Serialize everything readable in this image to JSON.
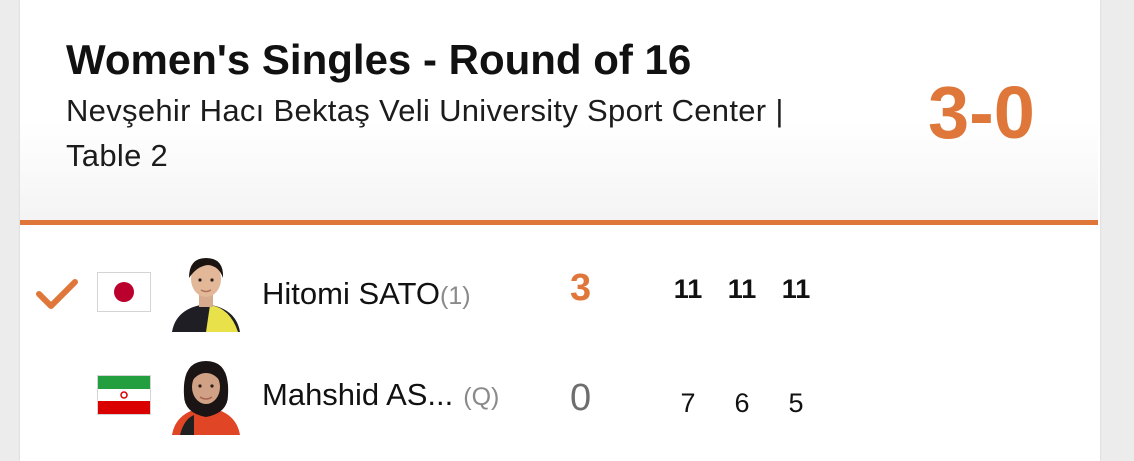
{
  "match": {
    "title": "Women's Singles - Round of 16",
    "venue": "Nevşehir Hacı Bektaş Veli University Sport Center | Table 2",
    "score": "3-0"
  },
  "players": [
    {
      "name": "Hitomi SATO",
      "seed": "(1)",
      "games": "3",
      "sets": [
        "11",
        "11",
        "11"
      ],
      "flag": "japan-flag",
      "winner": true
    },
    {
      "name": "Mahshid AS...",
      "seed": "(Q)",
      "games": "0",
      "sets": [
        "7",
        "6",
        "5"
      ],
      "flag": "iran-flag",
      "winner": false
    }
  ],
  "colors": {
    "accent": "#e0773a"
  }
}
